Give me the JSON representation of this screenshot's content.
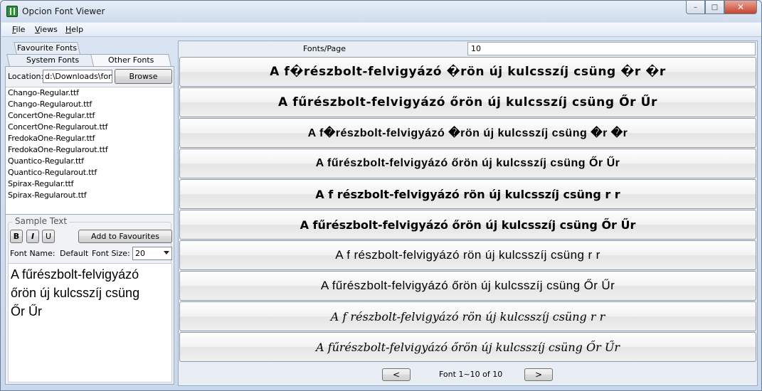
{
  "window": {
    "title": "Opcion Font Viewer",
    "controls": {
      "minimize": "–",
      "maximize": "□",
      "close": "✕"
    }
  },
  "menu": {
    "items": [
      "File",
      "Views",
      "Help"
    ]
  },
  "left_panel": {
    "tabs": {
      "favourites": "Favourite Fonts",
      "system": "System Fonts",
      "other": "Other Fonts",
      "active": "Other Fonts"
    },
    "location_label": "Location:",
    "location_value": "d:\\Downloads\\font",
    "browse_label": "Browse",
    "files": [
      "Chango-Regular.ttf",
      "Chango-Regularout.ttf",
      "ConcertOne-Regular.ttf",
      "ConcertOne-Regularout.ttf",
      "FredokaOne-Regular.ttf",
      "FredokaOne-Regularout.ttf",
      "Quantico-Regular.ttf",
      "Quantico-Regularout.ttf",
      "Spirax-Regular.ttf",
      "Spirax-Regularout.ttf"
    ],
    "sample": {
      "group_label": "Sample Text",
      "bold_label": "B",
      "italic_label": "I",
      "underline_label": "U",
      "add_favourites_label": "Add to Favourites",
      "font_name_label": "Font Name:",
      "font_name_value": "Default",
      "font_size_label": "Font Size:",
      "font_size_value": "20",
      "text_lines": [
        "A fűrészbolt-felvigyázó",
        "őrön új kulcsszíj csüng",
        "Őr Űr"
      ]
    }
  },
  "right_panel": {
    "fonts_per_page_label": "Fonts/Page",
    "fonts_per_page_value": "10",
    "previews": [
      "A f�részbolt-felvigyázó �rön új kulcsszíj csüng �r �r",
      "A fűrészbolt-felvigyázó őrön új kulcsszíj csüng Őr Űr",
      "A f�részbolt-felvigyázó �rön új kulcsszíj csüng �r �r",
      "A fűrészbolt-felvigyázó őrön új kulcsszíj csüng Őr Űr",
      "A f  részbolt-felvigyázó   rön új kulcsszíj csüng   r   r",
      "A fűrészbolt-felvigyázó őrön új kulcsszíj csüng Őr Űr",
      "A f részbolt-felvigyázó  rön új kulcsszíj csüng  r  r",
      "A fűrészbolt-felvigyázó őrön új kulcsszíj csüng Őr Űr",
      "A f részbolt-felvigyázó  rön új kulcsszíj csüng  r  r",
      "A fűrészbolt-felvigyázó őrön új kulcsszíj csüng Őr Űr"
    ],
    "pager": {
      "prev_label": "<",
      "next_label": ">",
      "status": "Font 1~10 of 10"
    }
  }
}
